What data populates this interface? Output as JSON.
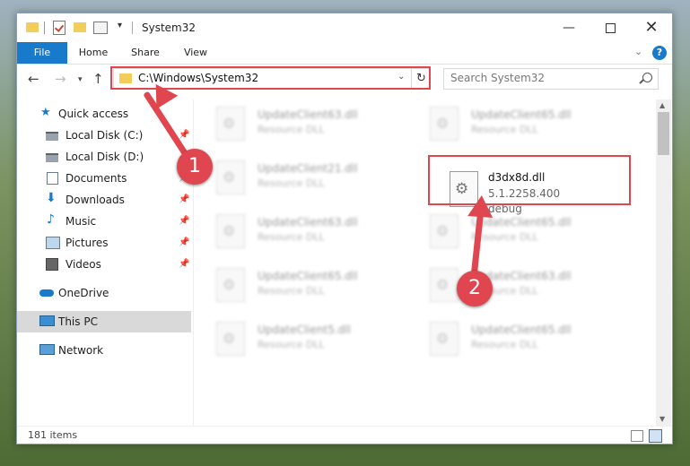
{
  "window": {
    "title": "System32"
  },
  "ribbon": {
    "tabs": [
      "File",
      "Home",
      "Share",
      "View"
    ],
    "help": "?"
  },
  "address": {
    "path": "C:\\Windows\\System32",
    "refresh_glyph": "↻"
  },
  "search": {
    "placeholder": "Search System32"
  },
  "nav": {
    "items": [
      {
        "label": "Quick access",
        "icon": "star-icon",
        "pinned": false
      },
      {
        "label": "Local Disk (C:)",
        "icon": "drive-icon",
        "pinned": true
      },
      {
        "label": "Local Disk (D:)",
        "icon": "drive-icon",
        "pinned": false
      },
      {
        "label": "Documents",
        "icon": "documents-icon",
        "pinned": true
      },
      {
        "label": "Downloads",
        "icon": "downloads-icon",
        "pinned": true
      },
      {
        "label": "Music",
        "icon": "music-icon",
        "pinned": true
      },
      {
        "label": "Pictures",
        "icon": "pictures-icon",
        "pinned": true
      },
      {
        "label": "Videos",
        "icon": "videos-icon",
        "pinned": true
      },
      {
        "label": "OneDrive",
        "icon": "onedrive-icon",
        "pinned": false
      },
      {
        "label": "This PC",
        "icon": "pc-icon",
        "pinned": false,
        "selected": true
      },
      {
        "label": "Network",
        "icon": "network-icon",
        "pinned": false
      }
    ]
  },
  "files": {
    "blurred": [
      {
        "name": "UpdateClient63.dll",
        "desc": "Resource DLL"
      },
      {
        "name": "UpdateClient65.dll",
        "desc": "Resource DLL"
      },
      {
        "name": "UpdateClient21.dll",
        "desc": "Resource DLL"
      },
      {
        "name": "UpdateClient63.dll",
        "desc": "Resource DLL"
      },
      {
        "name": "UpdateClient65.dll",
        "desc": "Resource DLL"
      },
      {
        "name": "UpdateClient65.dll",
        "desc": "Resource DLL"
      },
      {
        "name": "UpdateClient63.dll",
        "desc": "Resource DLL"
      },
      {
        "name": "UpdateClient5.dll",
        "desc": "Resource DLL"
      },
      {
        "name": "UpdateClient65.dll",
        "desc": "Resource DLL"
      }
    ],
    "target": {
      "name": "d3dx8d.dll",
      "version": "5.1.2258.400",
      "desc": "debug"
    }
  },
  "status": {
    "count": "181 items"
  },
  "callouts": {
    "one": "1",
    "two": "2"
  },
  "colors": {
    "accent": "#1979ca",
    "highlight": "#e0464f",
    "folder": "#f3cd5a"
  }
}
